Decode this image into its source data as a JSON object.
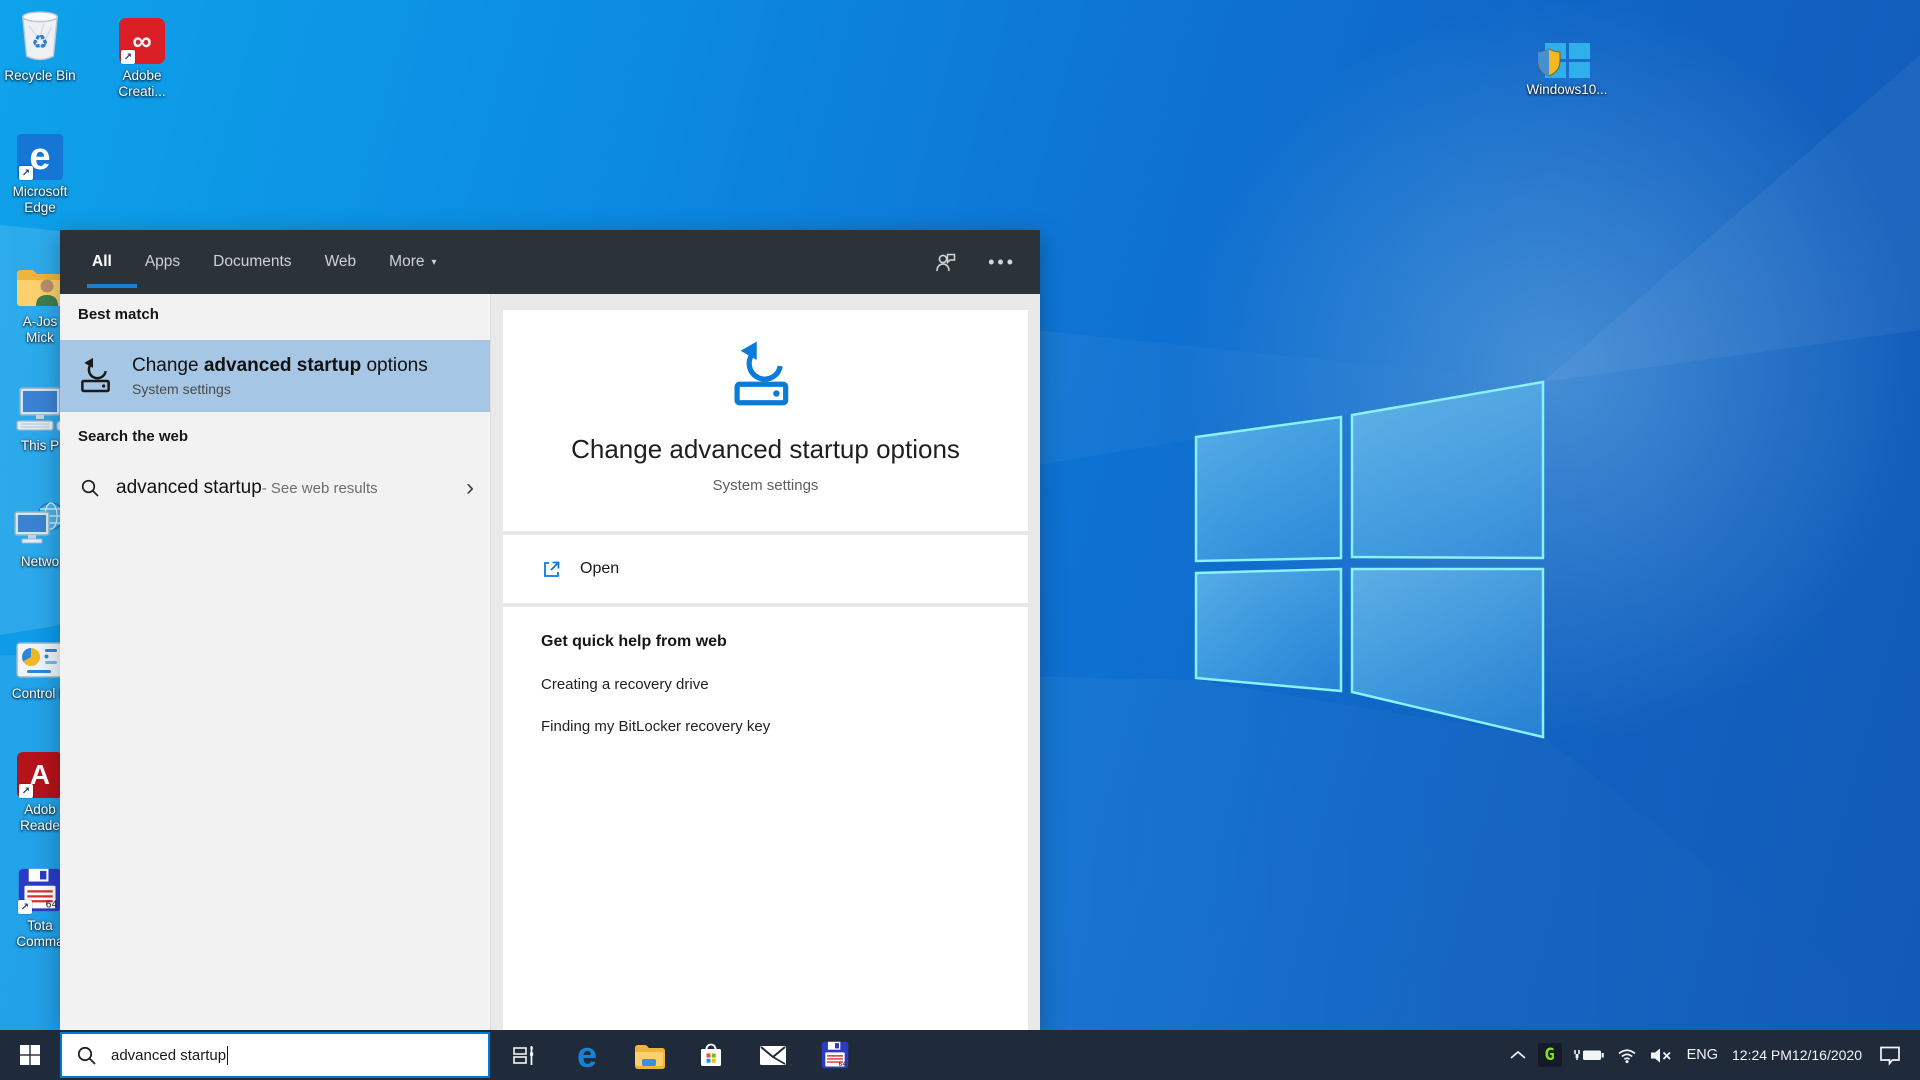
{
  "colors": {
    "accent": "#0078d7",
    "best_match_highlight": "#a6c6e6",
    "taskbar": "#1f2b3a",
    "tabbar": "#2b3238",
    "panel_left_bg": "#f2f2f2",
    "panel_right_bg": "#e9e9e9",
    "card_bg": "#ffffff",
    "detail_icon_blue": "#0c7bd8"
  },
  "glyphs": {
    "edge": "e",
    "cc": "∞",
    "recycle": "♻",
    "reader_a": "A",
    "tc_label": "64",
    "caret_down": "▾",
    "chevron_right": "›",
    "ellipsis": "•••",
    "shortcut_arrow": "↗"
  },
  "desktop": {
    "icons": [
      {
        "name": "recycle-bin",
        "lines": [
          "Recycle Bin",
          ""
        ]
      },
      {
        "name": "adobe-creative-cloud",
        "lines": [
          "Adobe",
          "Creati..."
        ]
      },
      {
        "name": "microsoft-edge",
        "lines": [
          "Microsoft",
          "Edge"
        ]
      },
      {
        "name": "user-folder",
        "lines": [
          "A-Jos",
          "Mick"
        ]
      },
      {
        "name": "this-pc",
        "lines": [
          "This P",
          ""
        ]
      },
      {
        "name": "network",
        "lines": [
          "Netwo",
          ""
        ]
      },
      {
        "name": "control-panel",
        "lines": [
          "Control P",
          ""
        ]
      },
      {
        "name": "adobe-reader",
        "lines": [
          "Adob",
          "Reade"
        ]
      },
      {
        "name": "total-commander",
        "lines": [
          "Tota",
          "Comma"
        ]
      }
    ],
    "windows10_label": "Windows10..."
  },
  "search_panel": {
    "tabs": [
      {
        "label": "All"
      },
      {
        "label": "Apps"
      },
      {
        "label": "Documents"
      },
      {
        "label": "Web"
      },
      {
        "label": "More"
      }
    ],
    "best_match_header": "Best match",
    "best_match": {
      "prefix": "Change ",
      "highlight": "advanced startup",
      "suffix": " options",
      "subtitle": "System settings"
    },
    "web_header": "Search the web",
    "web_item": {
      "query": "advanced startup",
      "suffix": " - See web results"
    },
    "detail": {
      "title": "Change advanced startup options",
      "subtitle": "System settings",
      "open_label": "Open",
      "help_header": "Get quick help from web",
      "help_links": [
        {
          "label": "Creating a recovery drive"
        },
        {
          "label": "Finding my BitLocker recovery key"
        }
      ]
    }
  },
  "taskbar": {
    "search_value": "advanced startup",
    "tray": {
      "language": "ENG",
      "time": "12:24 PM",
      "date": "12/16/2020"
    }
  }
}
